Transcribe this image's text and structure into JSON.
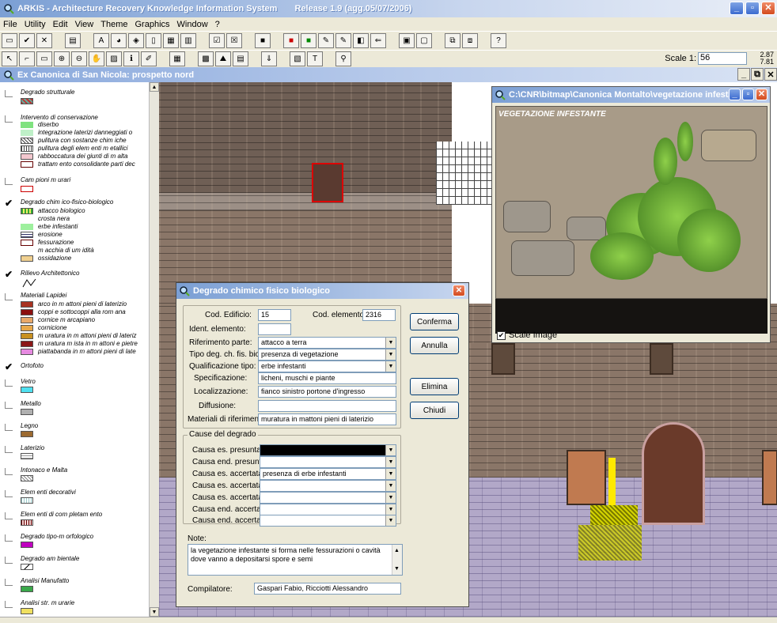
{
  "app": {
    "title": "ARKIS - Architecture Recovery Knowledge Information System",
    "release": "Release 1.9  (agg.05/07/2006)"
  },
  "menu": [
    "File",
    "Utility",
    "Edit",
    "View",
    "Theme",
    "Graphics",
    "Window",
    "?"
  ],
  "toolbar": {
    "scale_label": "Scale 1:",
    "scale_value": "56",
    "coord_x": "2.87",
    "coord_y": "7.81"
  },
  "document": {
    "title": "Ex Canonica di San Nicola: prospetto nord"
  },
  "legend": {
    "groups": [
      {
        "title": "Degrado strutturale",
        "checked": false,
        "items": []
      },
      {
        "title": "Intervento di conservazione",
        "checked": false,
        "items": [
          "diserbo",
          "integrazione laterizi danneggiati o",
          "pulitura con sostanze chim iche",
          "pulitura degli elem enti m etallici",
          "rabboccatura dei giunti di m alta",
          "trattam ento consolidante parti dec"
        ]
      },
      {
        "title": "Cam pioni m urari",
        "checked": false,
        "items": []
      },
      {
        "title": "Degrado chim ico-fisico-biologico",
        "checked": true,
        "items": [
          "attacco biologico",
          "crosta nera",
          "erbe infestanti",
          "erosione",
          "fessurazione",
          "m acchia di um idità",
          "ossidazione"
        ]
      },
      {
        "title": "Rilievo Architettonico",
        "checked": true,
        "items": []
      },
      {
        "title": "Materiali Lapidei",
        "checked": false,
        "items": [
          "arco in m attoni pieni di laterizio",
          "coppi e sottocoppi alla rom ana",
          "cornice m arcapiano",
          "cornicione",
          "m uratura in m attoni pieni di lateriz",
          "m uratura m ista in m attoni e pietre",
          "piattabanda in m attoni pieni di late"
        ]
      },
      {
        "title": "Ortofoto",
        "checked": true,
        "items": []
      },
      {
        "title": "Vetro",
        "checked": false,
        "items": []
      },
      {
        "title": "Metallo",
        "checked": false,
        "items": []
      },
      {
        "title": "Legno",
        "checked": false,
        "items": []
      },
      {
        "title": "Laterizio",
        "checked": false,
        "items": []
      },
      {
        "title": "Intonaco e Malta",
        "checked": false,
        "items": []
      },
      {
        "title": "Elem enti decorativi",
        "checked": false,
        "items": []
      },
      {
        "title": "Elem enti di com pletam ento",
        "checked": false,
        "items": []
      },
      {
        "title": "Degrado tipo-m orfologico",
        "checked": false,
        "items": []
      },
      {
        "title": "Degrado am bientale",
        "checked": false,
        "items": []
      },
      {
        "title": "Analisi Manufatto",
        "checked": false,
        "items": []
      },
      {
        "title": "Analisi str. m urarie",
        "checked": false,
        "items": []
      }
    ]
  },
  "image_window": {
    "title": "C:\\CNR\\bitmap\\Canonica Montalto\\vegetazione infestant...",
    "overlay_label": "VEGETAZIONE INFESTANTE",
    "scale_image_label": "Scale Image",
    "scale_image_checked": true
  },
  "dialog": {
    "title": "Degrado chimico fisico biologico",
    "cod_edificio_label": "Cod. Edificio:",
    "cod_edificio": "15",
    "cod_elemento_label": "Cod. elemento:",
    "cod_elemento": "2316",
    "ident_elemento_label": "Ident. elemento:",
    "ident_elemento": "",
    "riferimento_parte_label": "Riferimento parte:",
    "riferimento_parte": "attacco a terra",
    "tipo_deg_label": "Tipo deg. ch. fis. biol.:",
    "tipo_deg": "presenza di vegetazione",
    "qualificazione_label": "Qualificazione tipo:",
    "qualificazione": "erbe infestanti",
    "specificazione_label": "Specificazione:",
    "specificazione": "licheni, muschi e piante",
    "localizzazione_label": "Localizzazione:",
    "localizzazione": "fianco sinistro portone d'ingresso",
    "diffusione_label": "Diffusione:",
    "diffusione": "",
    "materiali_label": "Materiali di riferimento:",
    "materiali": "muratura in mattoni pieni di laterizio",
    "cause_group_label": "Cause del degrado",
    "cause": [
      {
        "label": "Causa es. presunta:",
        "value": ""
      },
      {
        "label": "Causa end. presunta:",
        "value": ""
      },
      {
        "label": "Causa es. accertata:",
        "value": "presenza di erbe infestanti"
      },
      {
        "label": "Causa es. accertata:",
        "value": ""
      },
      {
        "label": "Causa es. accertata:",
        "value": ""
      },
      {
        "label": "Causa end. accertata:",
        "value": ""
      },
      {
        "label": "Causa end. accertata:",
        "value": ""
      }
    ],
    "note_label": "Note:",
    "note_text": "la vegetazione infestante si forma nelle fessurazioni o cavità dove vanno a depositarsi spore e semi",
    "compilatore_label": "Compilatore:",
    "compilatore": "Gaspari Fabio, Ricciotti Alessandro",
    "buttons": {
      "conferma": "Conferma",
      "annulla": "Annulla",
      "elimina": "Elimina",
      "chiudi": "Chiudi"
    }
  },
  "colors": {
    "title_gradient_start": "#7b9fd4",
    "dialog_bg": "#ece9d8",
    "highlight_red": "#dd0000",
    "vegetation_yellow": "#ffe900"
  }
}
